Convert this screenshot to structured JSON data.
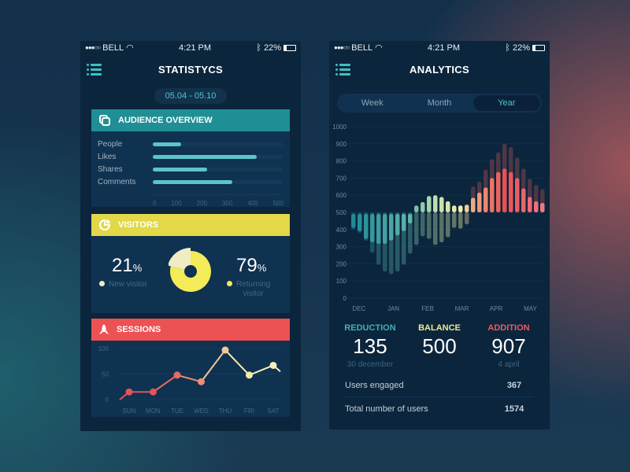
{
  "status": {
    "carrier": "BELL",
    "signal": "●●●○○",
    "time": "4:21 PM",
    "battery": "22%",
    "bluetooth_icon": "bluetooth-icon",
    "wifi_icon": "wifi-icon"
  },
  "left": {
    "title": "STATISTYCS",
    "date_range": "05.04 - 05.10",
    "audience": {
      "title": "AUDIENCE OVERVIEW",
      "icon": "copy-icon",
      "rows": [
        {
          "label": "People",
          "value": 110
        },
        {
          "label": "Likes",
          "value": 400
        },
        {
          "label": "Shares",
          "value": 210
        },
        {
          "label": "Comments",
          "value": 305
        }
      ],
      "axis": [
        "0",
        "100",
        "200",
        "300",
        "400",
        "500"
      ],
      "max": 500
    },
    "visitors": {
      "title": "VISITORS",
      "icon": "pie-chart-icon",
      "new_pct": "21",
      "new_label": "New visitor",
      "ret_pct": "79",
      "ret_label_1": "Returning",
      "ret_label_2": "visitor",
      "pct_sign": "%",
      "new_fraction": 0.21,
      "new_color": "#f1ecc4",
      "ret_color": "#f3eb58"
    },
    "sessions": {
      "title": "SESSIONS",
      "icon": "rocket-icon",
      "y_ticks": [
        "100",
        "50",
        "0"
      ],
      "days": [
        "SUN",
        "MON",
        "TUE",
        "WED",
        "THU",
        "FRI",
        "SAT"
      ]
    }
  },
  "chart_data": [
    {
      "type": "bar",
      "title": "Audience Overview",
      "categories": [
        "People",
        "Likes",
        "Shares",
        "Comments"
      ],
      "values": [
        110,
        400,
        210,
        305
      ],
      "xlim": [
        0,
        500
      ]
    },
    {
      "type": "pie",
      "title": "Visitors",
      "categories": [
        "New visitor",
        "Returning visitor"
      ],
      "values": [
        21,
        79
      ]
    },
    {
      "type": "line",
      "title": "Sessions",
      "categories": [
        "SUN",
        "MON",
        "TUE",
        "WED",
        "THU",
        "FRI",
        "SAT"
      ],
      "values": [
        15,
        15,
        48,
        35,
        97,
        48,
        67
      ],
      "ylim": [
        0,
        100
      ],
      "start": 0,
      "end": 55
    },
    {
      "type": "bar",
      "title": "Analytics (Year)",
      "baseline": 500,
      "ylim": [
        0,
        1000
      ],
      "y_ticks": [
        "1000",
        "900",
        "800",
        "700",
        "600",
        "500",
        "400",
        "300",
        "200",
        "100",
        "0"
      ],
      "x_labels": [
        "DEC",
        "JAN",
        "FEB",
        "MAR",
        "APR",
        "MAY"
      ],
      "values": [
        420,
        400,
        355,
        335,
        325,
        325,
        345,
        375,
        400,
        445,
        540,
        560,
        595,
        600,
        590,
        565,
        540,
        540,
        545,
        585,
        615,
        645,
        700,
        735,
        755,
        735,
        700,
        640,
        590,
        565,
        555
      ],
      "shadow": [
        400,
        380,
        335,
        265,
        195,
        155,
        140,
        155,
        195,
        260,
        310,
        360,
        345,
        310,
        325,
        355,
        410,
        405,
        430,
        650,
        680,
        750,
        810,
        850,
        900,
        880,
        820,
        755,
        695,
        660,
        635
      ]
    }
  ],
  "right": {
    "title": "ANALYTICS",
    "tabs": [
      "Week",
      "Month",
      "Year"
    ],
    "active_tab": "Year",
    "reduction": {
      "label": "REDUCTION",
      "value": "135",
      "date": "30 december"
    },
    "balance": {
      "label": "BALANCE",
      "value": "500"
    },
    "addition": {
      "label": "ADDITION",
      "value": "907",
      "date": "4 april"
    },
    "rows": [
      {
        "label": "Users engaged",
        "value": "367"
      },
      {
        "label": "Total number of users",
        "value": "1574"
      }
    ]
  },
  "colors": {
    "teal": "#208f95",
    "yellow": "#e2d848",
    "red": "#ec5153",
    "reduction": "#3fb0b9",
    "balance": "#ecea9a",
    "addition": "#ec5b62"
  }
}
